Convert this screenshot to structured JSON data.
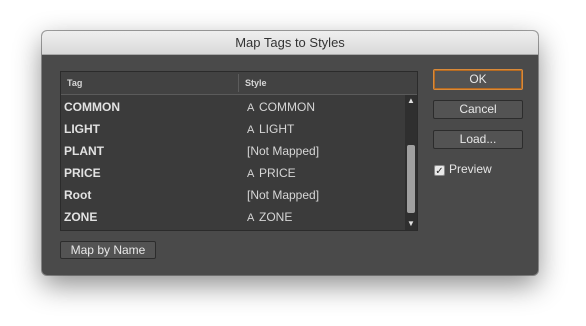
{
  "dialog": {
    "title": "Map Tags to Styles"
  },
  "list": {
    "headers": {
      "tag": "Tag",
      "style": "Style"
    },
    "rows": [
      {
        "tag": "COMMON",
        "style": "COMMON",
        "style_icon": "paragraph-style-icon"
      },
      {
        "tag": "LIGHT",
        "style": "LIGHT",
        "style_icon": "paragraph-style-icon"
      },
      {
        "tag": "PLANT",
        "style": "[Not Mapped]",
        "style_icon": ""
      },
      {
        "tag": "PRICE",
        "style": "PRICE",
        "style_icon": "paragraph-style-icon"
      },
      {
        "tag": "Root",
        "style": "[Not Mapped]",
        "style_icon": ""
      },
      {
        "tag": "ZONE",
        "style": "ZONE",
        "style_icon": "paragraph-style-icon"
      }
    ]
  },
  "buttons": {
    "ok": "OK",
    "cancel": "Cancel",
    "load": "Load...",
    "map_by_name": "Map by Name"
  },
  "preview": {
    "label": "Preview",
    "checked": true
  },
  "colors": {
    "dialog_bg": "#4a4a4a",
    "default_button_ring": "#d98a3a"
  }
}
